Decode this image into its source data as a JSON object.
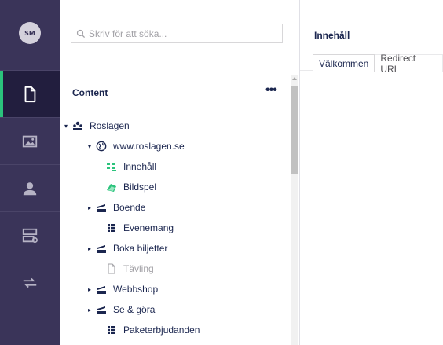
{
  "user": {
    "initials": "SM"
  },
  "sections": [
    {
      "name": "content",
      "icon": "document-icon",
      "active": true
    },
    {
      "name": "media",
      "icon": "image-icon",
      "active": false
    },
    {
      "name": "members",
      "icon": "user-icon",
      "active": false
    },
    {
      "name": "forms",
      "icon": "form-icon",
      "active": false
    },
    {
      "name": "redirects",
      "icon": "arrows-icon",
      "active": false
    }
  ],
  "search": {
    "placeholder": "Skriv för att söka..."
  },
  "tree": {
    "header": "Content",
    "menu": "•••",
    "nodes": [
      {
        "label": "Roslagen",
        "icon": "sitemap-icon",
        "caret": "▾"
      },
      {
        "label": "www.roslagen.se",
        "icon": "globe-icon",
        "caret": "▾"
      },
      {
        "label": "Innehåll",
        "icon": "grid-icon",
        "caret": ""
      },
      {
        "label": "Bildspel",
        "icon": "slideshow-icon",
        "caret": ""
      },
      {
        "label": "Boende",
        "icon": "folder-stack-icon",
        "caret": "▸"
      },
      {
        "label": "Evenemang",
        "icon": "list-icon",
        "caret": ""
      },
      {
        "label": "Boka biljetter",
        "icon": "folder-stack-icon",
        "caret": "▸"
      },
      {
        "label": "Tävling",
        "icon": "page-icon",
        "caret": ""
      },
      {
        "label": "Webbshop",
        "icon": "folder-stack-icon",
        "caret": "▸"
      },
      {
        "label": "Se & göra",
        "icon": "folder-stack-icon",
        "caret": "▸"
      },
      {
        "label": "Paketerbjudanden",
        "icon": "list-icon",
        "caret": ""
      }
    ]
  },
  "editor": {
    "title": "Innehåll",
    "tabs": [
      "Välkommen",
      "Redirect URL"
    ]
  },
  "colors": {
    "appbar": "#3a3459",
    "active_section": "#221e3e",
    "accent": "#2bc37c",
    "text": "#1b264f"
  }
}
